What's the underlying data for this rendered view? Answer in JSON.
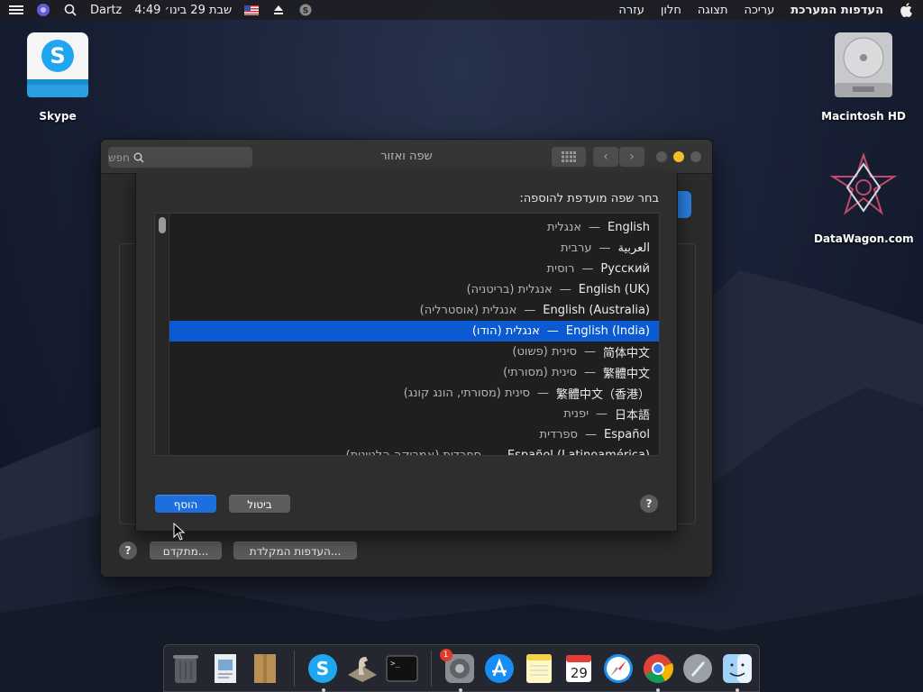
{
  "menubar": {
    "apple_icon": "apple-icon",
    "app_name": "העדפות המערכת",
    "menus": [
      "עריכה",
      "תצוגה",
      "חלון",
      "עזרה"
    ],
    "clock": "שבת 29 בינו׳ 4:49",
    "user": "Dartz"
  },
  "desktop": {
    "skype_label": "Skype",
    "hd_label": "Macintosh HD",
    "datawagon_label": "DataWagon.com"
  },
  "window": {
    "title": "שפה ואזור",
    "search_placeholder": "חפש",
    "keyboard_prefs_button": "העדפות המקלדת...",
    "advanced_button": "מתקדם...",
    "help": "?"
  },
  "sheet": {
    "heading": "בחר שפה מועדפת להוספה:",
    "languages": [
      {
        "native": "English",
        "translated": "אנגלית"
      },
      {
        "native": "العربية",
        "translated": "ערבית"
      },
      {
        "native": "Русский",
        "translated": "רוסית"
      },
      {
        "native": "English (UK)",
        "translated": "אנגלית (בריטניה)"
      },
      {
        "native": "English (Australia)",
        "translated": "אנגלית (אוסטרליה)"
      },
      {
        "native": "English (India)",
        "translated": "אנגלית (הודו)"
      },
      {
        "native": "简体中文",
        "translated": "סינית (פשוט)"
      },
      {
        "native": "繁體中文",
        "translated": "סינית (מסורתי)"
      },
      {
        "native": "繁體中文（香港）",
        "translated": "סינית (מסורתי, הונג קונג)"
      },
      {
        "native": "日本語",
        "translated": "יפנית"
      },
      {
        "native": "Español",
        "translated": "ספרדית"
      },
      {
        "native": "Español (Latinoamérica)",
        "translated": "ספרדית (אמריקה הלטינית)"
      }
    ],
    "selected_index": 5,
    "dash": "—",
    "add_button": "הוסף",
    "cancel_button": "ביטול",
    "help": "?"
  },
  "dock": {
    "apps": [
      "trash",
      "preview",
      "notes-file",
      "skype",
      "chess",
      "terminal",
      "system-preferences",
      "app-store",
      "notes",
      "calendar",
      "safari",
      "chrome",
      "launchpad",
      "finder"
    ],
    "sysprefs_badge": "1",
    "calendar_day": "29"
  },
  "colors": {
    "accent_blue": "#0b5ad1",
    "yellow_light": "#f4bd2d"
  }
}
